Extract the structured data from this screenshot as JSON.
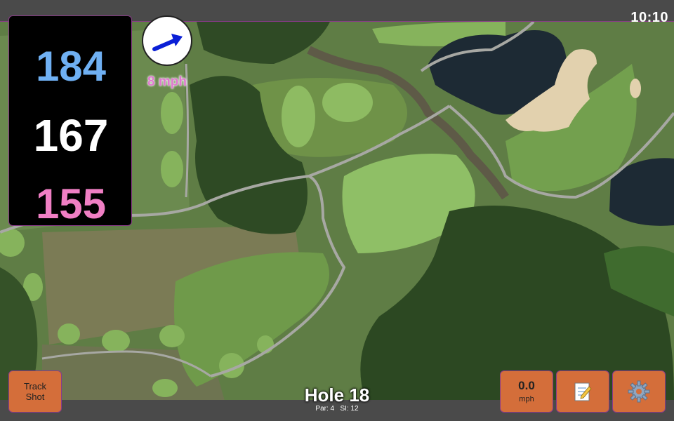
{
  "status": {
    "clock": "10:10"
  },
  "distances": {
    "back": "184",
    "center": "167",
    "front": "155"
  },
  "wind": {
    "speed_label": "8 mph",
    "icon": "wind-direction-arrow-icon"
  },
  "buttons": {
    "track_shot": "Track Shot",
    "speed_value": "0.0",
    "speed_unit": "mph",
    "notes_icon": "notepad-icon",
    "settings_icon": "gear-icon"
  },
  "hole": {
    "title": "Hole 18",
    "par": "Par: 4",
    "si": "SI: 12"
  },
  "colors": {
    "back_distance": "#6fb0f3",
    "center_distance": "#ffffff",
    "front_distance": "#f07fc4",
    "button_bg": "#d46e3a",
    "wind_label": "#e07ad0"
  }
}
